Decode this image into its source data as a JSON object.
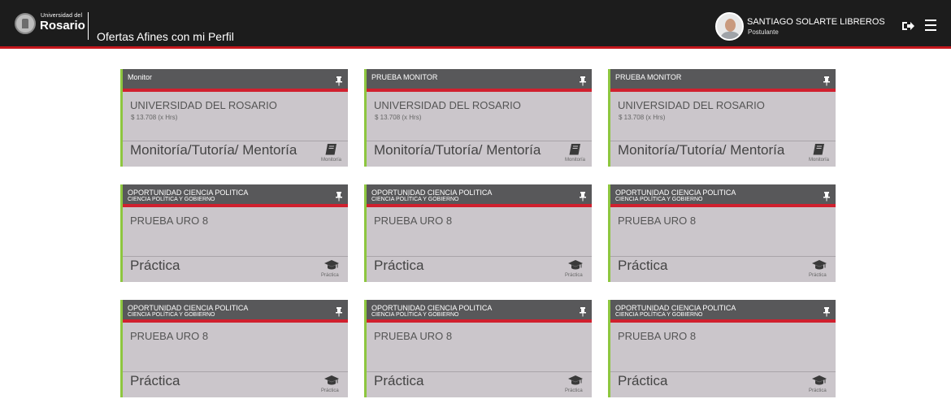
{
  "header": {
    "logo_small": "Universidad del",
    "logo_big": "Rosario",
    "title": "Ofertas Afines con mi Perfil",
    "user_name": "SANTIAGO SOLARTE LIBREROS",
    "user_role": "Postulante"
  },
  "colors": {
    "topbar": "#1c1c1c",
    "accent_red": "#d0202e",
    "accent_green": "#8dc63f",
    "card_bg": "#cbc6cb",
    "card_header": "#58585a"
  },
  "icons": {
    "logout": "sign-out-icon",
    "menu": "hamburger-menu-icon",
    "pin": "pin-icon",
    "book": "book-icon",
    "graduation": "graduation-cap-icon"
  },
  "cards": [
    {
      "title": "Monitor",
      "subtitle": "",
      "company": "UNIVERSIDAD DEL ROSARIO",
      "salary": "$ 13.708 (x Hrs)",
      "category": "Monitoría/Tutoría/ Mentoría",
      "type_label": "Monitoría",
      "icon": "book"
    },
    {
      "title": "PRUEBA MONITOR",
      "subtitle": "",
      "company": "UNIVERSIDAD DEL ROSARIO",
      "salary": "$ 13.708 (x Hrs)",
      "category": "Monitoría/Tutoría/ Mentoría",
      "type_label": "Monitoría",
      "icon": "book"
    },
    {
      "title": "PRUEBA MONITOR",
      "subtitle": "",
      "company": "UNIVERSIDAD DEL ROSARIO",
      "salary": "$ 13.708 (x Hrs)",
      "category": "Monitoría/Tutoría/ Mentoría",
      "type_label": "Monitoría",
      "icon": "book"
    },
    {
      "title": "OPORTUNIDAD CIENCIA POLITICA",
      "subtitle": "CIENCIA POLÍTICA Y GOBIERNO",
      "company": "PRUEBA URO 8",
      "salary": "",
      "category": "Práctica",
      "type_label": "Práctica",
      "icon": "graduation"
    },
    {
      "title": "OPORTUNIDAD CIENCIA POLITICA",
      "subtitle": "CIENCIA POLÍTICA Y GOBIERNO",
      "company": "PRUEBA URO 8",
      "salary": "",
      "category": "Práctica",
      "type_label": "Práctica",
      "icon": "graduation"
    },
    {
      "title": "OPORTUNIDAD CIENCIA POLITICA",
      "subtitle": "CIENCIA POLÍTICA Y GOBIERNO",
      "company": "PRUEBA URO 8",
      "salary": "",
      "category": "Práctica",
      "type_label": "Práctica",
      "icon": "graduation"
    },
    {
      "title": "OPORTUNIDAD CIENCIA POLITICA",
      "subtitle": "CIENCIA POLÍTICA Y GOBIERNO",
      "company": "PRUEBA URO 8",
      "salary": "",
      "category": "Práctica",
      "type_label": "Práctica",
      "icon": "graduation"
    },
    {
      "title": "OPORTUNIDAD CIENCIA POLITICA",
      "subtitle": "CIENCIA POLÍTICA Y GOBIERNO",
      "company": "PRUEBA URO 8",
      "salary": "",
      "category": "Práctica",
      "type_label": "Práctica",
      "icon": "graduation"
    },
    {
      "title": "OPORTUNIDAD CIENCIA POLITICA",
      "subtitle": "CIENCIA POLÍTICA Y GOBIERNO",
      "company": "PRUEBA URO 8",
      "salary": "",
      "category": "Práctica",
      "type_label": "Práctica",
      "icon": "graduation"
    }
  ]
}
